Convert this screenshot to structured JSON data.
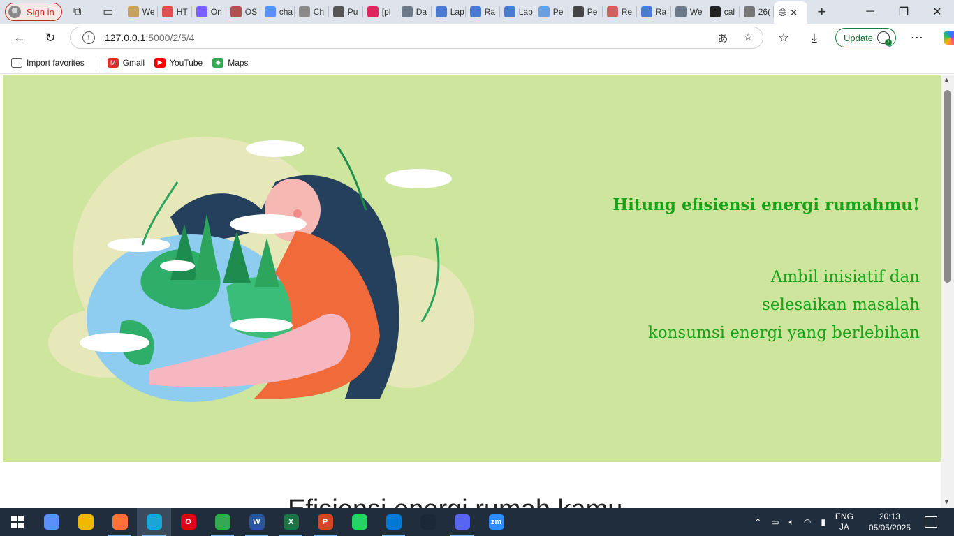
{
  "browser": {
    "signin_label": "Sign in",
    "tabs": [
      {
        "title": "We",
        "color": "#c8a060"
      },
      {
        "title": "HT",
        "color": "#e05050"
      },
      {
        "title": "On",
        "color": "#7b61ff"
      },
      {
        "title": "OS",
        "color": "#b05050"
      },
      {
        "title": "cha",
        "color": "#5b8ff9"
      },
      {
        "title": "Ch",
        "color": "#8a8a8a"
      },
      {
        "title": "Pu",
        "color": "#555555"
      },
      {
        "title": "[pl",
        "color": "#e0245e"
      },
      {
        "title": "Da",
        "color": "#6c7a89"
      },
      {
        "title": "Lap",
        "color": "#4a7bd0"
      },
      {
        "title": "Ra",
        "color": "#4a7bd0"
      },
      {
        "title": "Lap",
        "color": "#4a7bd0"
      },
      {
        "title": "Pe",
        "color": "#6aa0e0"
      },
      {
        "title": "Pe",
        "color": "#444444"
      },
      {
        "title": "Re",
        "color": "#d06060"
      },
      {
        "title": "Ra",
        "color": "#4a7bd0"
      },
      {
        "title": "We",
        "color": "#6c7a89"
      },
      {
        "title": "cal",
        "color": "#222222"
      },
      {
        "title": "26(",
        "color": "#777777"
      }
    ],
    "url_host": "127.0.0.1",
    "url_path": ":5000/2/5/4",
    "update_label": "Update",
    "favorites": [
      {
        "label": "Import favorites",
        "color": "#555555"
      },
      {
        "label": "Gmail",
        "color": "#d93025"
      },
      {
        "label": "YouTube",
        "color": "#ff0000"
      },
      {
        "label": "Maps",
        "color": "#34a853"
      }
    ]
  },
  "page": {
    "hero_title": "Hitung efisiensi energi rumahmu!",
    "hero_line1": "Ambil inisiatif dan",
    "hero_line2": "selesaikan masalah",
    "hero_line3": "konsumsi energi yang berlebihan",
    "section_title": "Efisiensi energi rumah kamu",
    "hero_bg": "#cde59d",
    "accent": "#17a217"
  },
  "taskbar": {
    "apps": [
      {
        "name": "copilot",
        "color": "#5b8ff9",
        "glyph": ""
      },
      {
        "name": "file-explorer",
        "color": "#f2b800",
        "glyph": ""
      },
      {
        "name": "firefox",
        "color": "#ff7139",
        "glyph": ""
      },
      {
        "name": "edge",
        "color": "#1aa5d6",
        "glyph": ""
      },
      {
        "name": "opera",
        "color": "#e0001b",
        "glyph": "O"
      },
      {
        "name": "chrome",
        "color": "#34a853",
        "glyph": ""
      },
      {
        "name": "word",
        "color": "#2b579a",
        "glyph": "W"
      },
      {
        "name": "excel",
        "color": "#217346",
        "glyph": "X"
      },
      {
        "name": "powerpoint",
        "color": "#d24726",
        "glyph": "P"
      },
      {
        "name": "whatsapp",
        "color": "#25d366",
        "glyph": ""
      },
      {
        "name": "vscode",
        "color": "#0078d4",
        "glyph": ""
      },
      {
        "name": "steam",
        "color": "#1b2838",
        "glyph": ""
      },
      {
        "name": "discord",
        "color": "#5865f2",
        "glyph": ""
      },
      {
        "name": "zoom",
        "color": "#2d8cff",
        "glyph": "zm"
      }
    ],
    "lang_top": "ENG",
    "lang_bottom": "JA",
    "time": "20:13",
    "date": "05/05/2025"
  }
}
